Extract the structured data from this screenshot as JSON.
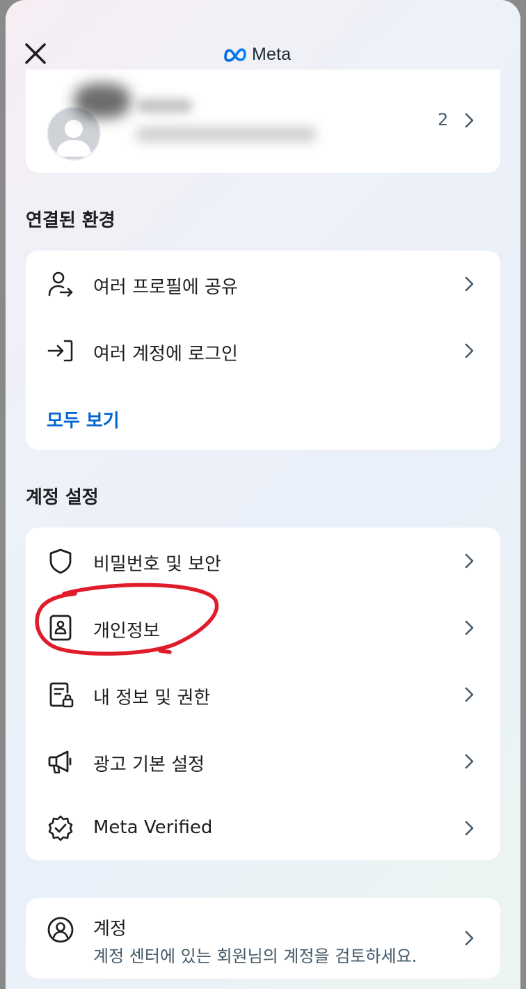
{
  "header": {
    "logo_text": "Meta",
    "close_icon": "close-icon",
    "logo_icon": "meta-infinity-icon"
  },
  "profile": {
    "count": "2"
  },
  "connected": {
    "title": "연결된 환경",
    "items": [
      {
        "label": "여러 프로필에 공유",
        "icon": "share-profiles-icon"
      },
      {
        "label": "여러 계정에 로그인",
        "icon": "login-arrow-icon"
      }
    ],
    "see_all": "모두 보기"
  },
  "account_settings": {
    "title": "계정 설정",
    "items": [
      {
        "label": "비밀번호 및 보안",
        "icon": "shield-icon"
      },
      {
        "label": "개인정보",
        "icon": "id-card-icon"
      },
      {
        "label": "내 정보 및 권한",
        "icon": "document-lock-icon"
      },
      {
        "label": "광고 기본 설정",
        "icon": "megaphone-icon"
      },
      {
        "label": "Meta Verified",
        "icon": "verified-badge-icon"
      }
    ]
  },
  "accounts": {
    "title": "계정",
    "subtitle": "계정 센터에 있는 회원님의 계정을 검토하세요.",
    "icon": "user-circle-icon"
  },
  "colors": {
    "accent_link": "#0064d1",
    "annotation": "#e01b2a"
  }
}
